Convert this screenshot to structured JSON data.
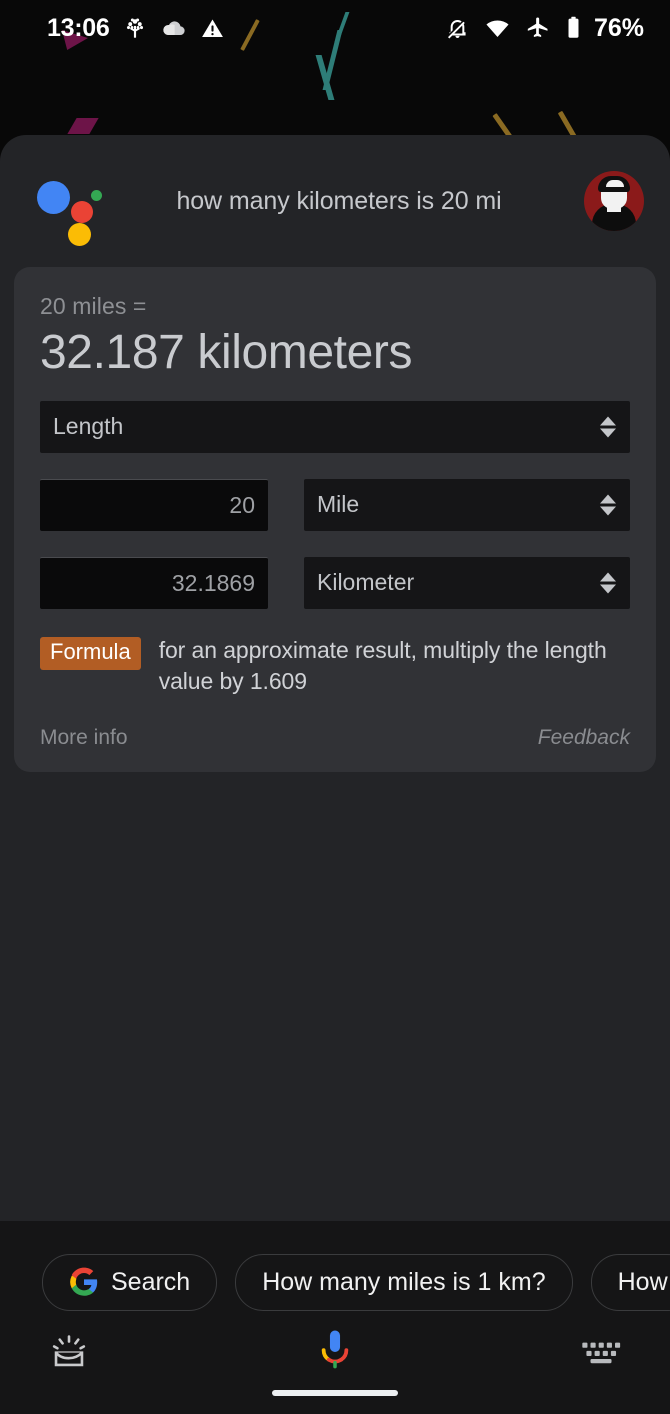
{
  "statusbar": {
    "time": "13:06",
    "battery_percent": "76%",
    "left_icons": [
      "tree-icon",
      "cloud-icon",
      "warning-triangle-icon"
    ],
    "right_icons": [
      "notifications-off-icon",
      "wifi-icon",
      "airplane-mode-icon",
      "battery-icon"
    ]
  },
  "assistant": {
    "logo": "google-assistant-icon",
    "query": "how many kilometers is 20 mi",
    "avatar": "user-avatar"
  },
  "card": {
    "subtitle": "20 miles =",
    "result": "32.187 kilometers",
    "category_select": {
      "value": "Length",
      "icon": "spinner-arrows-icon"
    },
    "from": {
      "value": "20",
      "unit": "Mile",
      "icon": "spinner-arrows-icon"
    },
    "to": {
      "value": "32.1869",
      "unit": "Kilometer",
      "icon": "spinner-arrows-icon"
    },
    "formula": {
      "badge": "Formula",
      "badge_color": "#b25d24",
      "text": "for an approximate result, multiply the length value by 1.609"
    },
    "more_info": "More info",
    "feedback": "Feedback"
  },
  "suggestions": [
    {
      "label": "Search",
      "icon": "google-g-icon"
    },
    {
      "label": "How many miles is 1 km?",
      "icon": ""
    },
    {
      "label": "How",
      "icon": ""
    }
  ],
  "toolbar": {
    "left_icon": "explore-lens-icon",
    "center_icon": "google-mic-icon",
    "right_icon": "keyboard-icon"
  },
  "colors": {
    "panel_bg": "#232427",
    "card_bg": "#313236",
    "bottom_bg": "#151516",
    "accent_blue": "#4285f4",
    "accent_red": "#ea4335",
    "accent_yellow": "#fbbc05",
    "accent_green": "#34a853",
    "formula_orange": "#b25d24"
  }
}
